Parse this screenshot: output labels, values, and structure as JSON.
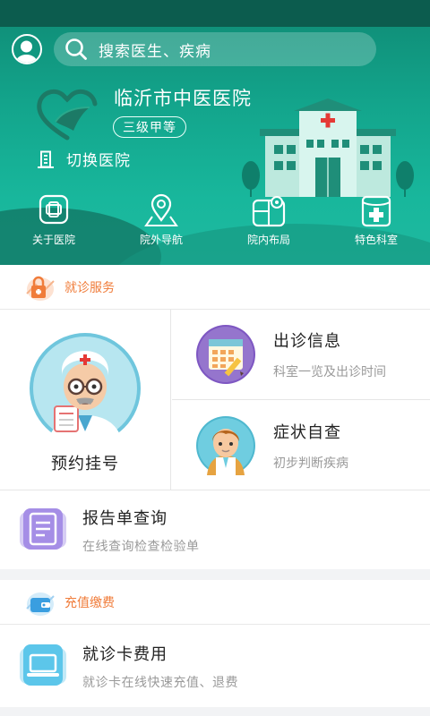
{
  "header": {
    "search_placeholder": "搜索医生、疾病",
    "hospital_name": "临沂市中医医院",
    "hospital_level": "三级甲等",
    "switch_label": "切换医院"
  },
  "quick_nav": [
    {
      "label": "关于医院",
      "icon": "hospital-cross-icon"
    },
    {
      "label": "院外导航",
      "icon": "map-pin-icon"
    },
    {
      "label": "院内布局",
      "icon": "floor-map-icon"
    },
    {
      "label": "特色科室",
      "icon": "medical-kit-icon"
    }
  ],
  "consult_section": {
    "title": "就诊服务",
    "register": {
      "label": "预约挂号"
    },
    "schedule": {
      "title": "出诊信息",
      "subtitle": "科室一览及出诊时间"
    },
    "symptom": {
      "title": "症状自查",
      "subtitle": "初步判断疾病"
    },
    "report": {
      "title": "报告单查询",
      "subtitle": "在线查询检查检验单"
    }
  },
  "payment_section": {
    "title": "充值缴费",
    "card_fee": {
      "title": "就诊卡费用",
      "subtitle": "就诊卡在线快速充值、退费"
    }
  },
  "colors": {
    "header_green": "#18b79c",
    "accent_orange": "#f07c3a",
    "muted_text": "#9a9a9a"
  }
}
